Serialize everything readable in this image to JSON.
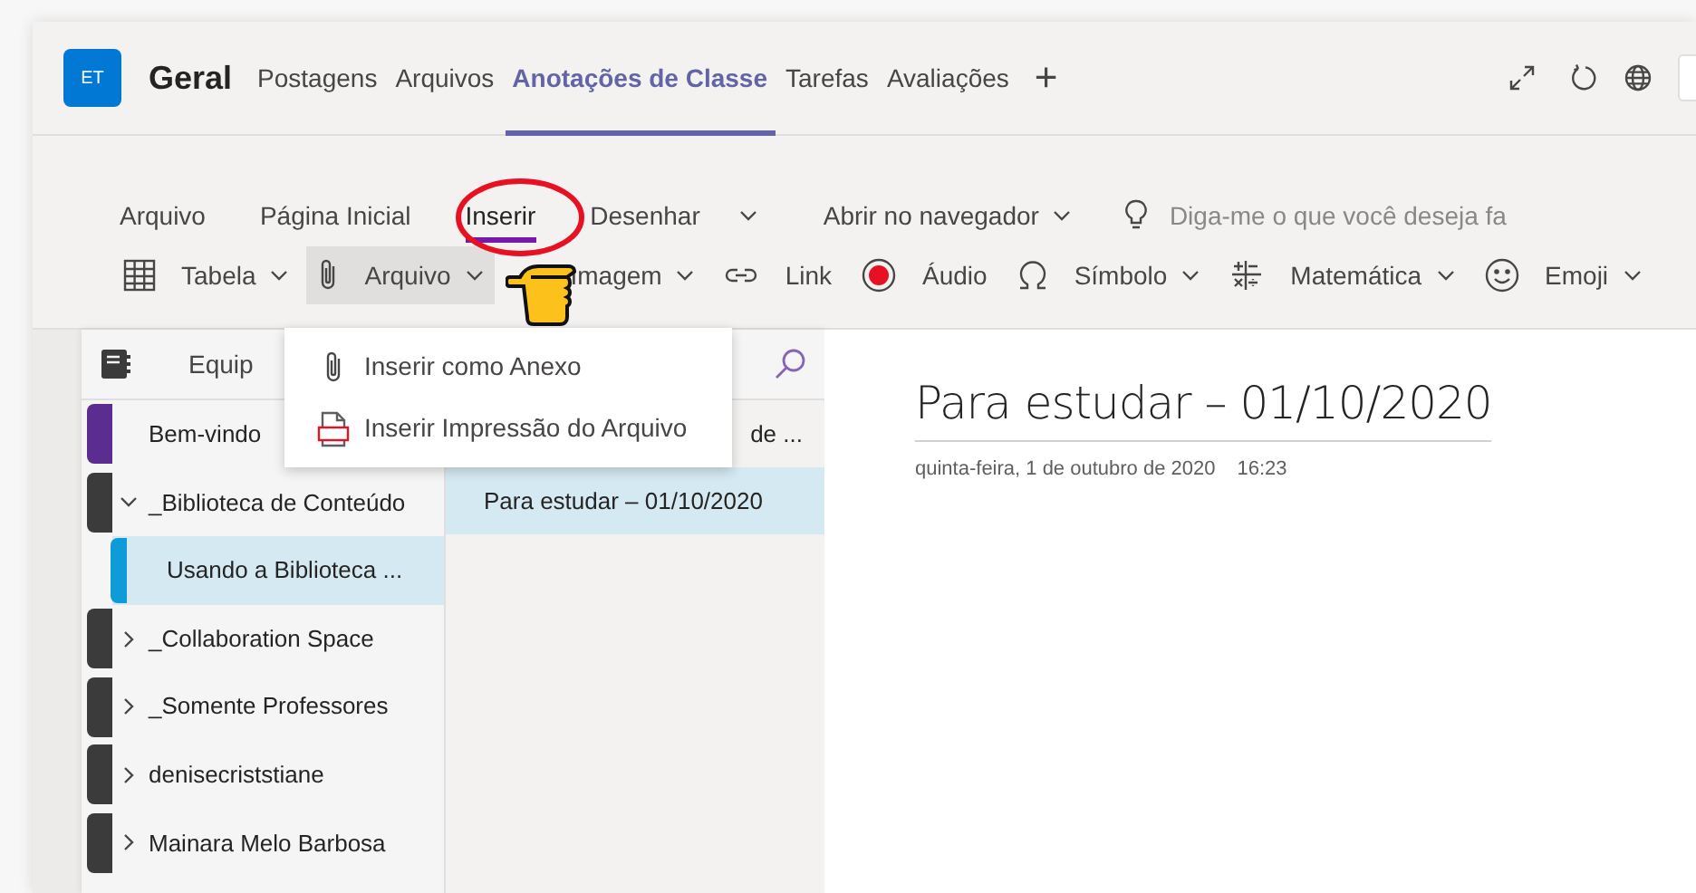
{
  "header": {
    "team_avatar": "ET",
    "channel": "Geral",
    "tabs": [
      {
        "label": "Postagens",
        "selected": false
      },
      {
        "label": "Arquivos",
        "selected": false
      },
      {
        "label": "Anotações de Classe",
        "selected": true
      },
      {
        "label": "Tarefas",
        "selected": false
      },
      {
        "label": "Avaliações",
        "selected": false
      }
    ],
    "add_tab": "+"
  },
  "ribbon": {
    "tabs": [
      {
        "label": "Arquivo",
        "selected": false
      },
      {
        "label": "Página Inicial",
        "selected": false
      },
      {
        "label": "Inserir",
        "selected": true
      },
      {
        "label": "Desenhar",
        "selected": false
      }
    ],
    "open_in_browser": "Abrir no navegador",
    "tell_me": {
      "placeholder": "Diga-me o que você deseja fa"
    },
    "tools": [
      {
        "kind": "table",
        "label": "Tabela",
        "dropdown": true,
        "open": false
      },
      {
        "kind": "attachment",
        "label": "Arquivo",
        "dropdown": true,
        "open": true
      },
      {
        "kind": "image",
        "label": "Imagem",
        "dropdown": true,
        "open": false
      },
      {
        "kind": "link",
        "label": "Link",
        "dropdown": false,
        "open": false
      },
      {
        "kind": "audio",
        "label": "Áudio",
        "dropdown": false,
        "open": false
      },
      {
        "kind": "symbol",
        "label": "Símbolo",
        "dropdown": true,
        "open": false
      },
      {
        "kind": "math",
        "label": "Matemática",
        "dropdown": true,
        "open": false
      },
      {
        "kind": "emoji",
        "label": "Emoji",
        "dropdown": true,
        "open": false
      }
    ]
  },
  "file_menu": {
    "items": [
      {
        "kind": "attachment",
        "label": "Inserir como Anexo"
      },
      {
        "kind": "pdf",
        "label": "Inserir Impressão do Arquivo"
      }
    ]
  },
  "notebook": {
    "name": "Equip",
    "sections": [
      {
        "kind": "section",
        "label": "Bem-vindo",
        "color": "#5c2d91",
        "selected": false
      },
      {
        "kind": "group",
        "label": "_Biblioteca de Conteúdo",
        "color": "#3b3b3b",
        "expanded": true,
        "children": [
          {
            "label": "Usando a Biblioteca ...",
            "color": "#0f9bd7",
            "selected": true
          }
        ]
      },
      {
        "kind": "group",
        "label": "_Collaboration Space",
        "color": "#3b3b3b",
        "expanded": false
      },
      {
        "kind": "group",
        "label": "_Somente Professores",
        "color": "#3b3b3b",
        "expanded": false
      },
      {
        "kind": "group",
        "label": "denisecriststiane",
        "color": "#3b3b3b",
        "expanded": false
      },
      {
        "kind": "group",
        "label": "Mainara Melo Barbosa",
        "color": "#3b3b3b",
        "expanded": false
      }
    ]
  },
  "pages": [
    {
      "label": "de ...",
      "selected": false
    },
    {
      "label": "Para estudar – 01/10/2020",
      "selected": true
    }
  ],
  "page": {
    "title": "Para estudar – 01/10/2020",
    "date": "quinta-feira, 1 de outubro de 2020",
    "time": "16:23"
  }
}
